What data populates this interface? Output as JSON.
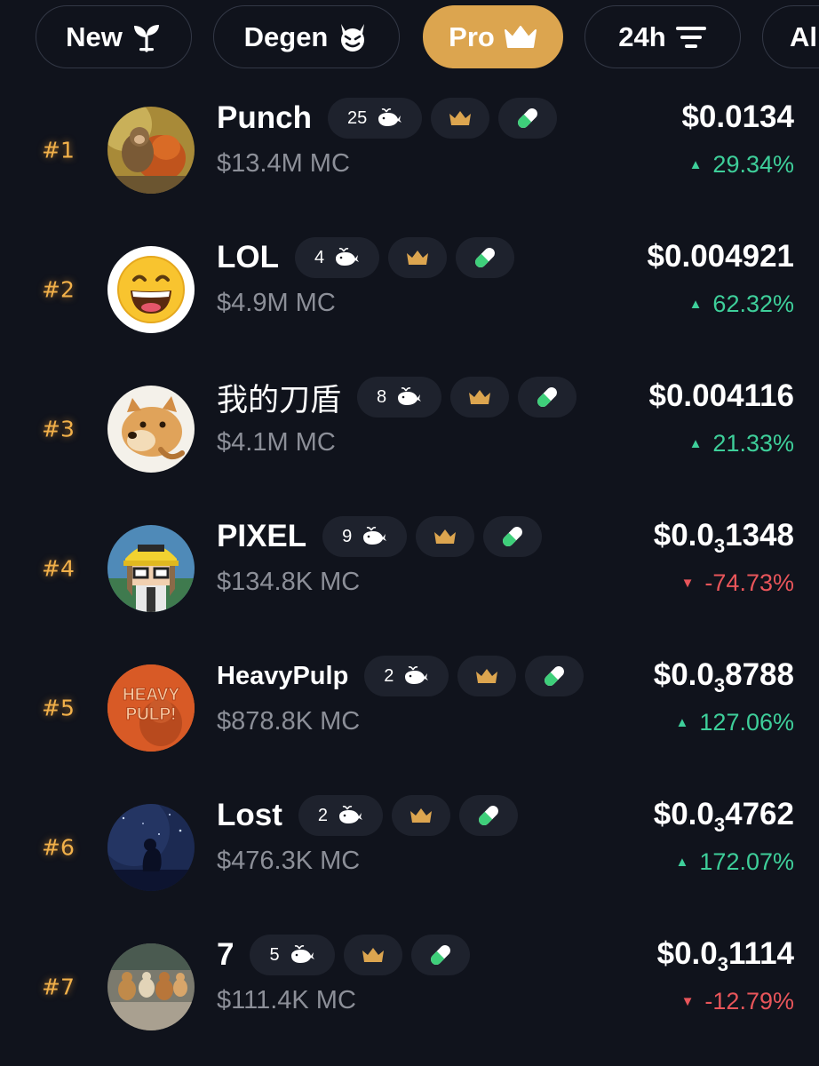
{
  "colors": {
    "background": "#10131c",
    "accent": "#dca54f",
    "rank": "#f2b14a",
    "up": "#3ecf9a",
    "down": "#e8555a",
    "muted": "#8c8f98",
    "pill": "#1e222d"
  },
  "tabs": [
    {
      "label": "New",
      "icon": "sprout-icon",
      "active": false
    },
    {
      "label": "Degen",
      "icon": "devil-icon",
      "active": false
    },
    {
      "label": "Pro",
      "icon": "crown-icon",
      "active": true
    },
    {
      "label": "24h",
      "icon": "filter-icon",
      "active": false
    },
    {
      "label": "Al",
      "icon": "",
      "active": false
    }
  ],
  "tokens": [
    {
      "rank": "#1",
      "name": "Punch",
      "whales": "25",
      "mc": "$13.4M MC",
      "price_main": "$0.0134",
      "price_sub": "",
      "price_tail": "",
      "change": "29.34%",
      "direction": "up",
      "avatar": "monkey-image"
    },
    {
      "rank": "#2",
      "name": "LOL",
      "whales": "4",
      "mc": "$4.9M MC",
      "price_main": "$0.004921",
      "price_sub": "",
      "price_tail": "",
      "change": "62.32%",
      "direction": "up",
      "avatar": "laughing-emoji-image"
    },
    {
      "rank": "#3",
      "name": "我的刀盾",
      "whales": "8",
      "mc": "$4.1M MC",
      "price_main": "$0.004116",
      "price_sub": "",
      "price_tail": "",
      "change": "21.33%",
      "direction": "up",
      "avatar": "doge-image"
    },
    {
      "rank": "#4",
      "name": "PIXEL",
      "whales": "9",
      "mc": "$134.8K MC",
      "price_main": "$0.0",
      "price_sub": "3",
      "price_tail": "1348",
      "change": "-74.73%",
      "direction": "down",
      "avatar": "pixel-character-image"
    },
    {
      "rank": "#5",
      "name": "HeavyPulp",
      "whales": "2",
      "mc": "$878.8K MC",
      "price_main": "$0.0",
      "price_sub": "3",
      "price_tail": "8788",
      "change": "127.06%",
      "direction": "up",
      "avatar": "heavy-pulp-poster-image"
    },
    {
      "rank": "#6",
      "name": "Lost",
      "whales": "2",
      "mc": "$476.3K MC",
      "price_main": "$0.0",
      "price_sub": "3",
      "price_tail": "4762",
      "change": "172.07%",
      "direction": "up",
      "avatar": "night-sky-figure-image"
    },
    {
      "rank": "#7",
      "name": "7",
      "whales": "5",
      "mc": "$111.4K MC",
      "price_main": "$0.0",
      "price_sub": "3",
      "price_tail": "1114",
      "change": "-12.79%",
      "direction": "down",
      "avatar": "dogs-photo-image"
    }
  ]
}
